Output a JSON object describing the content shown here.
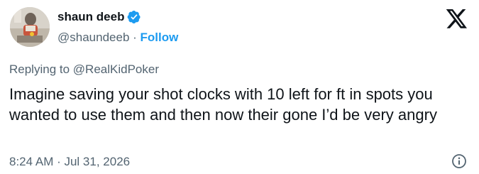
{
  "author": {
    "display_name": "shaun deeb",
    "handle": "@shaundeeb",
    "separator": " · ",
    "follow_label": "Follow",
    "verified": true
  },
  "reply": {
    "prefix": "Replying to ",
    "mention": "@RealKidPoker"
  },
  "tweet": {
    "text": "Imagine saving your shot clocks with 10 left for ft in spots you wanted to use them and then now their gone I’d be very angry",
    "timestamp": "8:24 AM · Jul 31, 2026"
  },
  "colors": {
    "text": "#0f1419",
    "secondary": "#536471",
    "accent": "#1d9bf0"
  },
  "icons": {
    "brand": "x-logo-icon",
    "verified": "verified-badge-icon",
    "info": "info-icon"
  }
}
